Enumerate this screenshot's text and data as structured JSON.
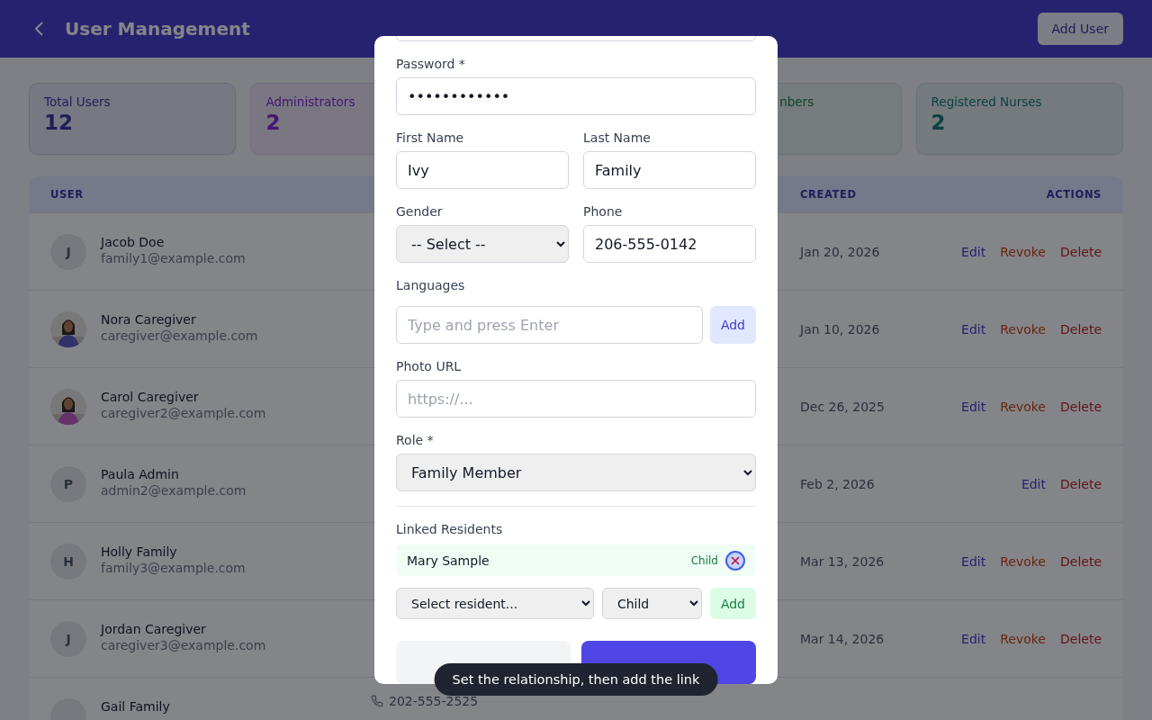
{
  "header": {
    "title": "User Management",
    "add_button": "Add User"
  },
  "stats": [
    {
      "label": "Total Users",
      "value": "12",
      "kind": "users",
      "partly_covered": false
    },
    {
      "label": "Administrators",
      "value": "2",
      "kind": "admins",
      "partly_covered": false
    },
    {
      "label": "nbers",
      "kind": "family",
      "partly_covered": true
    },
    {
      "label": "Registered Nurses",
      "value": "2",
      "kind": "nurses",
      "partly_covered": false
    }
  ],
  "table": {
    "columns": [
      {
        "kind": "user",
        "label": "USER"
      },
      {
        "kind": "created",
        "label": "CREATED"
      },
      {
        "kind": "actions",
        "label": "ACTIONS"
      }
    ],
    "rows": [
      {
        "name": "Jacob Doe",
        "email": "family1@example.com",
        "avatar": {
          "kind": "initial",
          "text": "J"
        },
        "created": "Jan 20, 2026",
        "actions": [
          {
            "kind": "edit",
            "label": "Edit"
          },
          {
            "kind": "revoke",
            "label": "Revoke"
          },
          {
            "kind": "delete",
            "label": "Delete"
          }
        ]
      },
      {
        "name": "Nora Caregiver",
        "email": "caregiver@example.com",
        "avatar": {
          "kind": "picture"
        },
        "created": "Jan 10, 2026",
        "actions": [
          {
            "kind": "edit",
            "label": "Edit"
          },
          {
            "kind": "revoke",
            "label": "Revoke"
          },
          {
            "kind": "delete",
            "label": "Delete"
          }
        ]
      },
      {
        "name": "Carol Caregiver",
        "email": "caregiver2@example.com",
        "avatar": {
          "kind": "picture"
        },
        "created": "Dec 26, 2025",
        "actions": [
          {
            "kind": "edit",
            "label": "Edit"
          },
          {
            "kind": "revoke",
            "label": "Revoke"
          },
          {
            "kind": "delete",
            "label": "Delete"
          }
        ]
      },
      {
        "name": "Paula Admin",
        "email": "admin2@example.com",
        "avatar": {
          "kind": "initial",
          "text": "P"
        },
        "created": "Feb 2, 2026",
        "actions": [
          {
            "kind": "edit",
            "label": "Edit"
          },
          {
            "kind": "delete",
            "label": "Delete"
          }
        ]
      },
      {
        "name": "Holly Family",
        "email": "family3@example.com",
        "avatar": {
          "kind": "initial",
          "text": "H"
        },
        "created": "Mar 13, 2026",
        "actions": [
          {
            "kind": "edit",
            "label": "Edit"
          },
          {
            "kind": "revoke",
            "label": "Revoke"
          },
          {
            "kind": "delete",
            "label": "Delete"
          }
        ]
      },
      {
        "name": "Jordan Caregiver",
        "email": "caregiver3@example.com",
        "avatar": {
          "kind": "initial",
          "text": "J"
        },
        "created": "Mar 14, 2026",
        "actions": [
          {
            "kind": "edit",
            "label": "Edit"
          },
          {
            "kind": "revoke",
            "label": "Revoke"
          },
          {
            "kind": "delete",
            "label": "Delete"
          }
        ]
      },
      {
        "name": "Gail Family",
        "avatar": {
          "kind": "cut"
        },
        "phone": "202-555-2525"
      }
    ]
  },
  "modal": {
    "password": {
      "label": "Password *",
      "value": "••••••••••••"
    },
    "first_name": {
      "label": "First Name",
      "value": "Ivy"
    },
    "last_name": {
      "label": "Last Name",
      "value": "Family"
    },
    "gender": {
      "label": "Gender",
      "value": "-- Select --"
    },
    "phone": {
      "label": "Phone",
      "value": "206-555-0142"
    },
    "languages": {
      "label": "Languages",
      "placeholder": "Type and press Enter",
      "button": "Add"
    },
    "photo_url": {
      "label": "Photo URL",
      "placeholder": "https://..."
    },
    "role": {
      "label": "Role *",
      "value": "Family Member"
    },
    "linked_residents": {
      "label": "Linked Residents",
      "items": [
        {
          "name": "Mary Sample",
          "relationship": "Child",
          "remove_focused": true
        }
      ],
      "resident_select": "Select resident...",
      "relationship_select": "Child",
      "button": "Add"
    },
    "buttons": [
      {
        "kind": "secondary"
      },
      {
        "kind": "primary"
      }
    ]
  },
  "toast": "Set the relationship, then add the link"
}
